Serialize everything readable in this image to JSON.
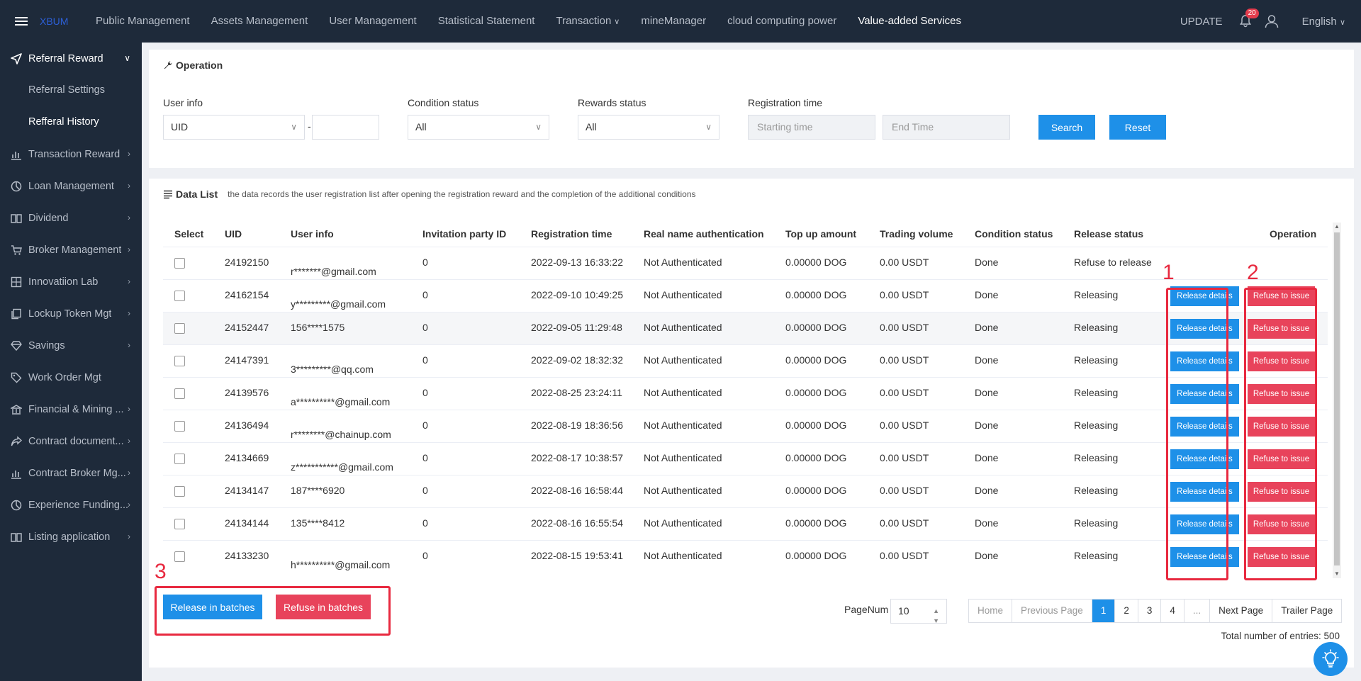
{
  "header": {
    "logo_text": "XBUM",
    "nav": [
      "Public Management",
      "Assets Management",
      "User Management",
      "Statistical Statement",
      "Transaction",
      "mineManager",
      "cloud computing power",
      "Value-added Services"
    ],
    "update_label": "UPDATE",
    "notification_count": "20",
    "language": "English"
  },
  "sidebar": {
    "open_group": "Referral Reward",
    "sub_items": [
      "Referral Settings",
      "Refferal History"
    ],
    "items": [
      "Transaction Reward",
      "Loan Management",
      "Dividend",
      "Broker Management",
      "Innovatiion Lab",
      "Lockup Token Mgt",
      "Savings",
      "Work Order Mgt",
      "Financial & Mining ...",
      "Contract document...",
      "Contract Broker Mg...",
      "Experience Funding...",
      "Listing application"
    ]
  },
  "operation": {
    "title": "Operation",
    "user_info_label": "User info",
    "user_info_select": "UID",
    "condition_label": "Condition status",
    "condition_value": "All",
    "rewards_label": "Rewards status",
    "rewards_value": "All",
    "reg_time_label": "Registration time",
    "start_placeholder": "Starting time",
    "end_placeholder": "End Time",
    "search_btn": "Search",
    "reset_btn": "Reset"
  },
  "data_list": {
    "title": "Data List",
    "description": "the data records the user registration list after opening the registration reward and the completion of the additional conditions",
    "columns": [
      "Select",
      "UID",
      "User info",
      "Invitation party ID",
      "Registration time",
      "Real name authentication",
      "Top up amount",
      "Trading volume",
      "Condition status",
      "Release status",
      "Operation"
    ],
    "rows": [
      {
        "uid": "24192150",
        "user": "r*******@gmail.com",
        "inviter": "0",
        "time": "2022-09-13 16:33:22",
        "auth": "Not Authenticated",
        "topup": "0.00000 DOG",
        "volume": "0.00 USDT",
        "condition": "Done",
        "release": "Refuse to release"
      },
      {
        "uid": "24162154",
        "user": "y*********@gmail.com",
        "inviter": "0",
        "time": "2022-09-10 10:49:25",
        "auth": "Not Authenticated",
        "topup": "0.00000 DOG",
        "volume": "0.00 USDT",
        "condition": "Done",
        "release": "Releasing"
      },
      {
        "uid": "24152447",
        "user": "156****1575",
        "inviter": "0",
        "time": "2022-09-05 11:29:48",
        "auth": "Not Authenticated",
        "topup": "0.00000 DOG",
        "volume": "0.00 USDT",
        "condition": "Done",
        "release": "Releasing"
      },
      {
        "uid": "24147391",
        "user": "3*********@qq.com",
        "inviter": "0",
        "time": "2022-09-02 18:32:32",
        "auth": "Not Authenticated",
        "topup": "0.00000 DOG",
        "volume": "0.00 USDT",
        "condition": "Done",
        "release": "Releasing"
      },
      {
        "uid": "24139576",
        "user": "a**********@gmail.com",
        "inviter": "0",
        "time": "2022-08-25 23:24:11",
        "auth": "Not Authenticated",
        "topup": "0.00000 DOG",
        "volume": "0.00 USDT",
        "condition": "Done",
        "release": "Releasing"
      },
      {
        "uid": "24136494",
        "user": "r********@chainup.com",
        "inviter": "0",
        "time": "2022-08-19 18:36:56",
        "auth": "Not Authenticated",
        "topup": "0.00000 DOG",
        "volume": "0.00 USDT",
        "condition": "Done",
        "release": "Releasing"
      },
      {
        "uid": "24134669",
        "user": "z***********@gmail.com",
        "inviter": "0",
        "time": "2022-08-17 10:38:57",
        "auth": "Not Authenticated",
        "topup": "0.00000 DOG",
        "volume": "0.00 USDT",
        "condition": "Done",
        "release": "Releasing"
      },
      {
        "uid": "24134147",
        "user": "187****6920",
        "inviter": "0",
        "time": "2022-08-16 16:58:44",
        "auth": "Not Authenticated",
        "topup": "0.00000 DOG",
        "volume": "0.00 USDT",
        "condition": "Done",
        "release": "Releasing"
      },
      {
        "uid": "24134144",
        "user": "135****8412",
        "inviter": "0",
        "time": "2022-08-16 16:55:54",
        "auth": "Not Authenticated",
        "topup": "0.00000 DOG",
        "volume": "0.00 USDT",
        "condition": "Done",
        "release": "Releasing"
      },
      {
        "uid": "24133230",
        "user": "h**********@gmail.com",
        "inviter": "0",
        "time": "2022-08-15 19:53:41",
        "auth": "Not Authenticated",
        "topup": "0.00000 DOG",
        "volume": "0.00 USDT",
        "condition": "Done",
        "release": "Releasing"
      }
    ],
    "release_btn": "Release details",
    "refuse_btn": "Refuse to issue",
    "batch_release": "Release in batches",
    "batch_refuse": "Refuse in batches"
  },
  "annotations": [
    "1",
    "2",
    "3"
  ],
  "pagination": {
    "pagenum_label": "PageNum",
    "page_size": "10",
    "pages": [
      "Home",
      "Previous Page",
      "1",
      "2",
      "3",
      "4",
      "...",
      "Next Page",
      "Trailer Page"
    ],
    "current": "1",
    "total_label": "Total number of entries:",
    "total": "500"
  },
  "colors": {
    "nav_bg": "#1e2a3a",
    "primary": "#1e90e8",
    "danger": "#e8435b",
    "annotation": "#e8293f"
  }
}
